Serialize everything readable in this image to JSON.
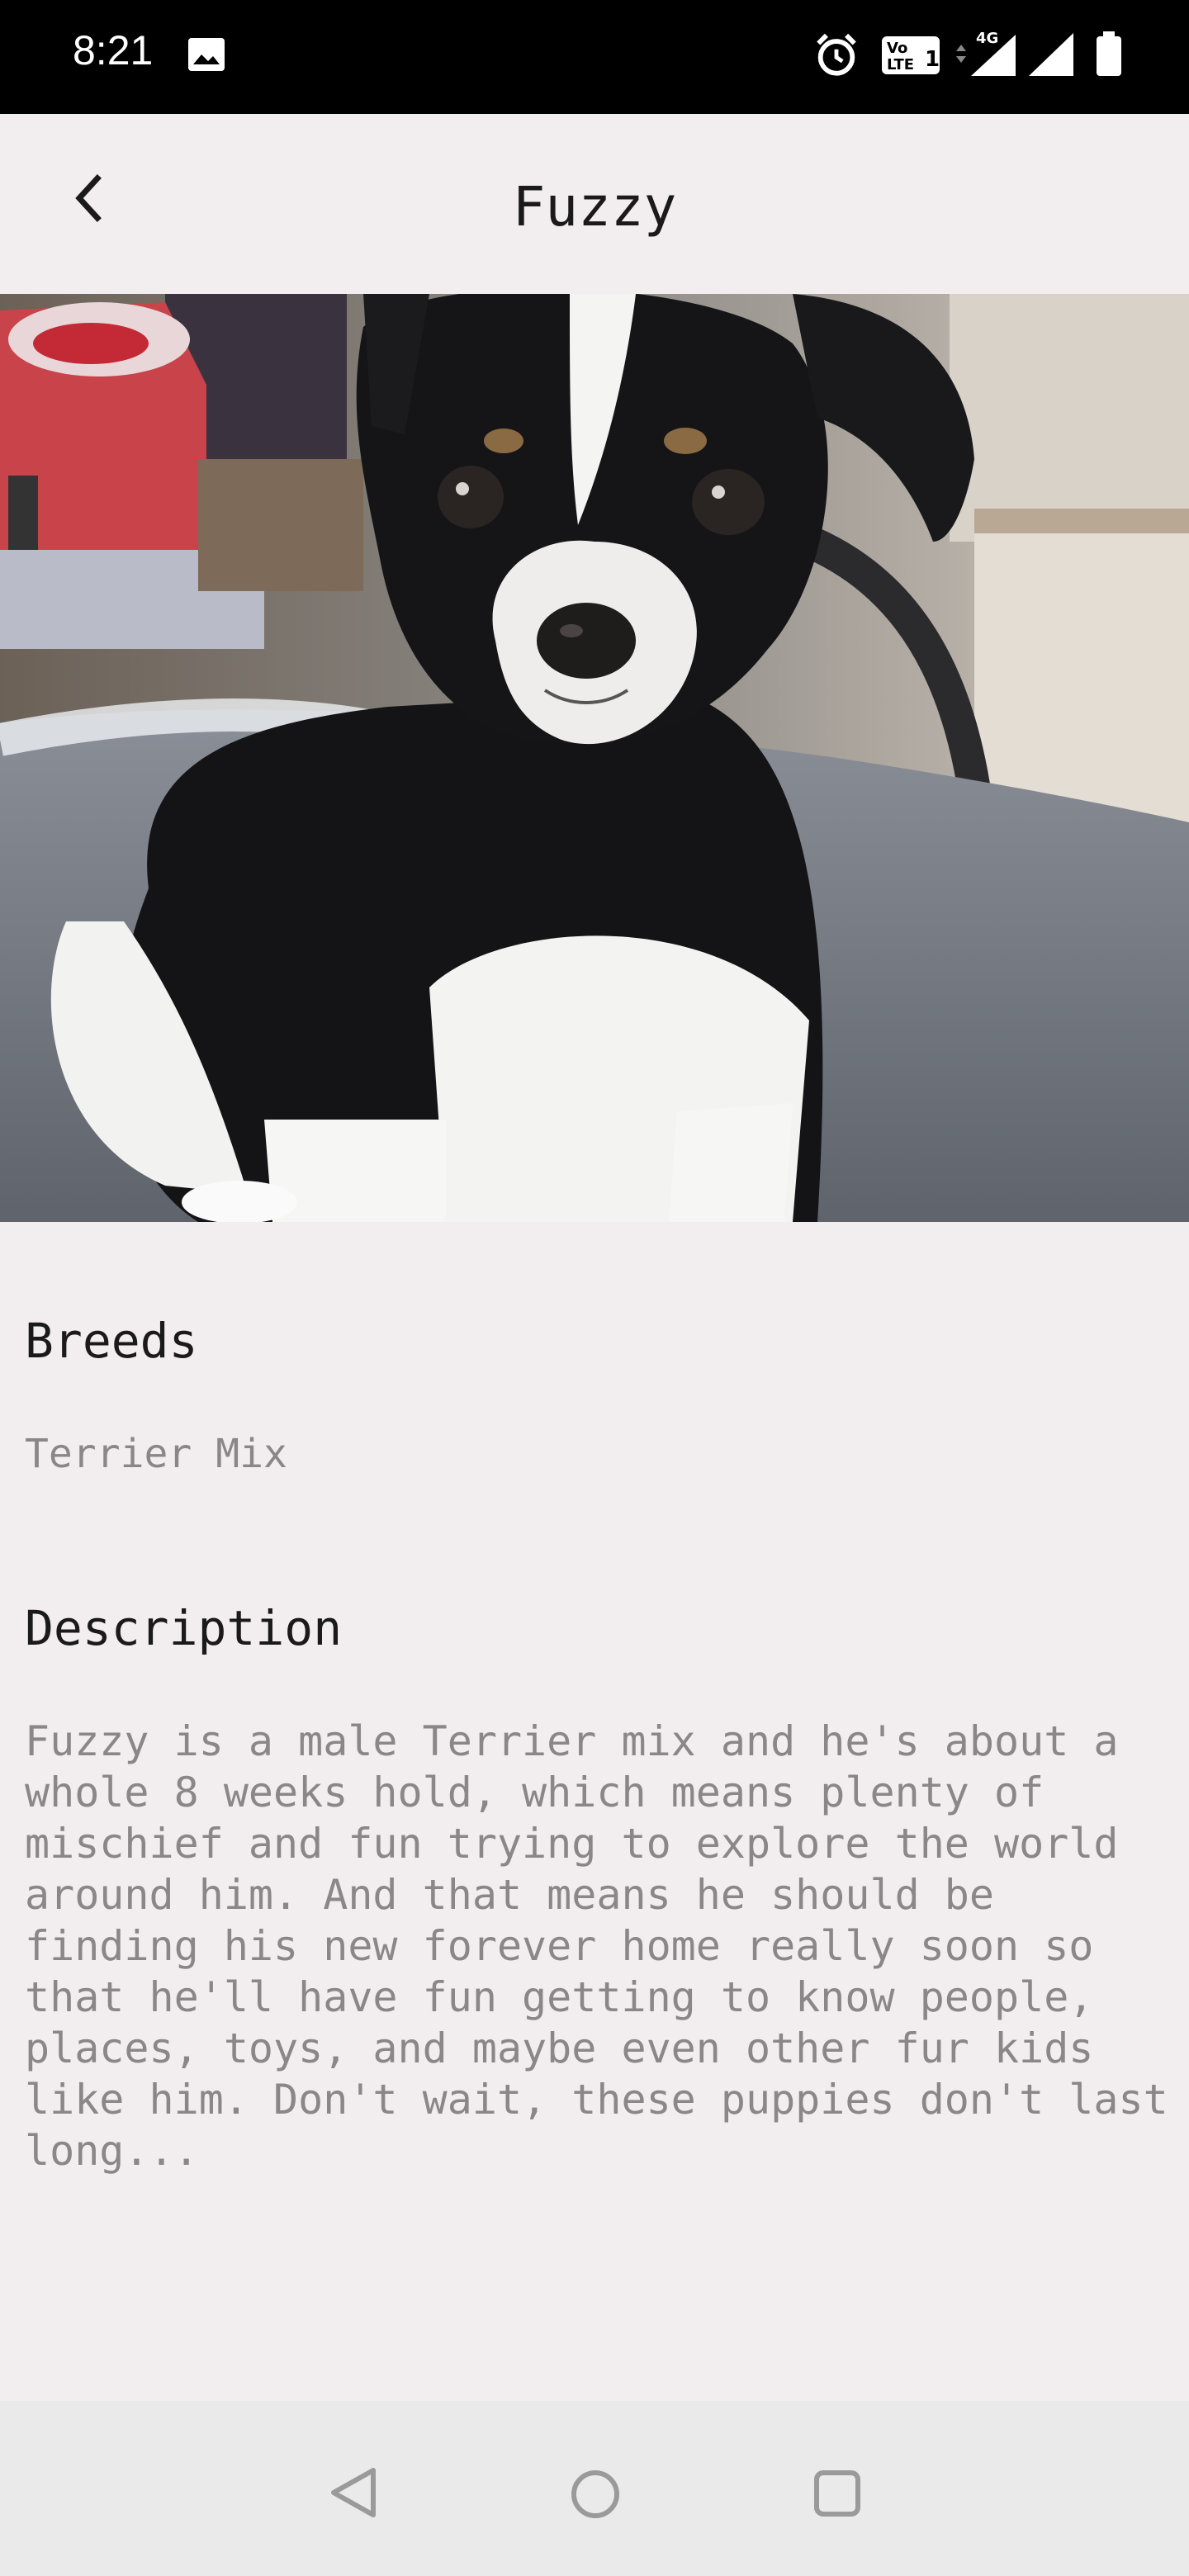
{
  "status_bar": {
    "time": "8:21",
    "icons": [
      "gallery-icon",
      "alarm-icon",
      "volte-icon",
      "4g-signal-icon",
      "signal-icon",
      "battery-icon"
    ],
    "network_label": "4G",
    "volte_label": "Vo LTE 1"
  },
  "toolbar": {
    "title": "Fuzzy",
    "back_icon": "chevron-left-icon"
  },
  "hero": {
    "subject": "black-and-white puppy photo"
  },
  "details": {
    "breeds_heading": "Breeds",
    "breeds_value": "Terrier Mix",
    "description_heading": "Description",
    "description": "Fuzzy is a male Terrier mix and he's about a whole 8 weeks hold, which means plenty of mischief and fun trying to explore the world around him. And that means he should be finding his new forever home really soon so that he'll have fun getting to know people, places, toys, and maybe even other fur kids like him. Don't wait, these puppies don't last long..."
  },
  "nav_bar": {
    "icons": [
      "nav-back-icon",
      "nav-home-icon",
      "nav-recents-icon"
    ]
  },
  "colors": {
    "background": "#F2EEF0",
    "status_bar": "#000000",
    "nav_bar": "#EAEAEA",
    "heading_text": "#1A1A1A",
    "secondary_text": "#8B8789"
  }
}
